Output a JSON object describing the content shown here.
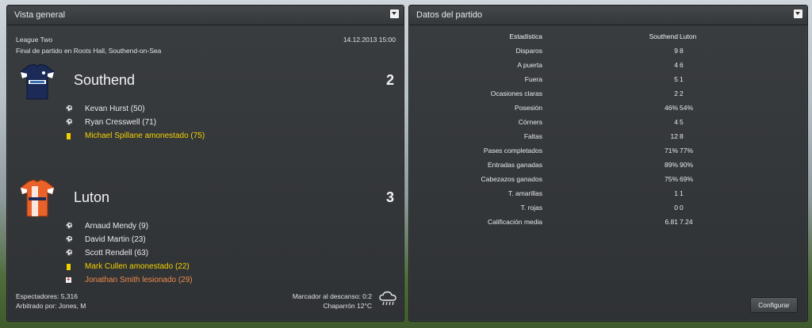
{
  "overview": {
    "title": "Vista general",
    "competition": "League Two",
    "datetime": "14.12.2013 15:00",
    "result_line": "Final de partido en Roots Hall, Southend-on-Sea",
    "home": {
      "name": "Southend",
      "score": "2",
      "kit_colors": [
        "#1b2a57",
        "#ffffff"
      ],
      "events": [
        {
          "type": "goal",
          "icon": "ball-icon",
          "text": "Kevan Hurst (50)"
        },
        {
          "type": "goal",
          "icon": "ball-icon",
          "text": "Ryan Cresswell (71)"
        },
        {
          "type": "yellow",
          "icon": "yellow-card-icon",
          "text": "Michael Spillane amonestado (75)"
        }
      ]
    },
    "away": {
      "name": "Luton",
      "score": "3",
      "kit_colors": [
        "#e8622a",
        "#ffffff"
      ],
      "events": [
        {
          "type": "goal",
          "icon": "ball-icon",
          "text": "Arnaud Mendy (9)"
        },
        {
          "type": "goal",
          "icon": "ball-icon",
          "text": "David Martin (23)"
        },
        {
          "type": "goal",
          "icon": "ball-icon",
          "text": "Scott Rendell (63)"
        },
        {
          "type": "yellow",
          "icon": "yellow-card-icon",
          "text": "Mark Cullen amonestado (22)"
        },
        {
          "type": "injury",
          "icon": "injury-icon",
          "text": "Jonathan Smith lesionado (29)"
        }
      ]
    },
    "spectators": "Espectadores: 5,316",
    "referee": "Arbitrado por: Jones, M",
    "halftime": "Marcador al descanso: 0:2",
    "weather": "Chaparrón 12°C",
    "weather_icon": "rain-cloud-icon"
  },
  "stats": {
    "title": "Datos del partido",
    "header": {
      "label": "Estadística",
      "home": "Southend",
      "away": "Luton"
    },
    "rows": [
      {
        "label": "Disparos",
        "home": "9",
        "away": "8"
      },
      {
        "label": "A puerta",
        "home": "4",
        "away": "6"
      },
      {
        "label": "Fuera",
        "home": "5",
        "away": "1"
      },
      {
        "label": "Ocasiones claras",
        "home": "2",
        "away": "2"
      },
      {
        "label": "Posesión",
        "home": "46%",
        "away": "54%"
      },
      {
        "label": "Córners",
        "home": "4",
        "away": "5"
      },
      {
        "label": "Faltas",
        "home": "12",
        "away": "8"
      },
      {
        "label": "Pases completados",
        "home": "71%",
        "away": "77%"
      },
      {
        "label": "Entradas ganadas",
        "home": "89%",
        "away": "90%"
      },
      {
        "label": "Cabezazos ganados",
        "home": "75%",
        "away": "69%"
      },
      {
        "label": "T. amarillas",
        "home": "1",
        "away": "1"
      },
      {
        "label": "T. rojas",
        "home": "0",
        "away": "0"
      },
      {
        "label": "Calificación media",
        "home": "6.81",
        "away": "7.24"
      }
    ],
    "configure_label": "Configurar"
  },
  "colors": {
    "yellow_card": "#f3d100",
    "injury_text": "#f08a4b",
    "panel_bg": "#333639"
  }
}
